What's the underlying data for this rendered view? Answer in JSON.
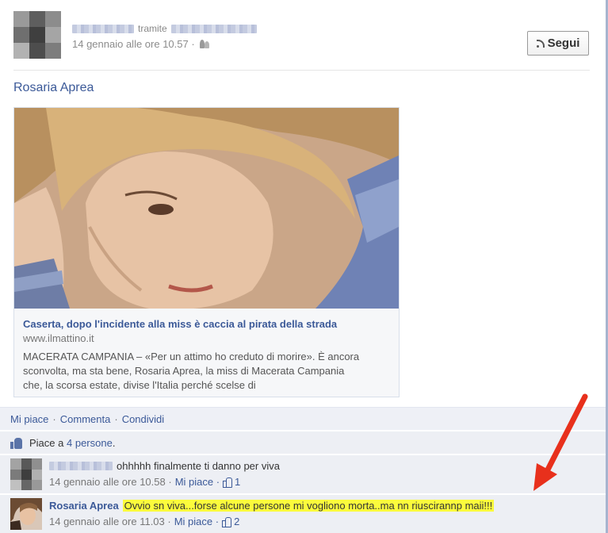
{
  "post": {
    "via_text": "tramite",
    "timestamp": "14 gennaio alle ore 10.57 ·",
    "privacy_icon": "friends-icon",
    "follow_label": "Segui",
    "follow_icon": "rss-icon",
    "author_tag": "Rosaria Aprea"
  },
  "link": {
    "title": "Caserta, dopo l'incidente alla miss è caccia al pirata della strada",
    "domain": "www.ilmattino.it",
    "description": "MACERATA CAMPANIA – «Per un attimo ho creduto di morire». È ancora sconvolta, ma sta bene, Rosaria Aprea, la miss di Macerata Campania che, la scorsa estate, divise l'Italia perché scelse di"
  },
  "actions": {
    "like": "Mi piace",
    "comment": "Commenta",
    "share": "Condividi"
  },
  "likes": {
    "prefix": "Piace a",
    "count_link": "4 persone",
    "suffix": "."
  },
  "comments": [
    {
      "author": "",
      "text": "ohhhhh finalmente ti danno per viva",
      "timestamp": "14 gennaio alle ore 10.58 ·",
      "like_label": "Mi piace ·",
      "like_count": "1"
    },
    {
      "author": "Rosaria Aprea",
      "text": "Ovvio sn viva...forse alcune persone mi vogliono morta..ma nn riuscirannp maii!!!",
      "timestamp": "14 gennaio alle ore 11.03 ·",
      "like_label": "Mi piace ·",
      "like_count": "2"
    }
  ],
  "colors": {
    "link_blue": "#3b5998",
    "highlight": "#fbfb3c",
    "annotation_arrow": "#e8301c"
  }
}
